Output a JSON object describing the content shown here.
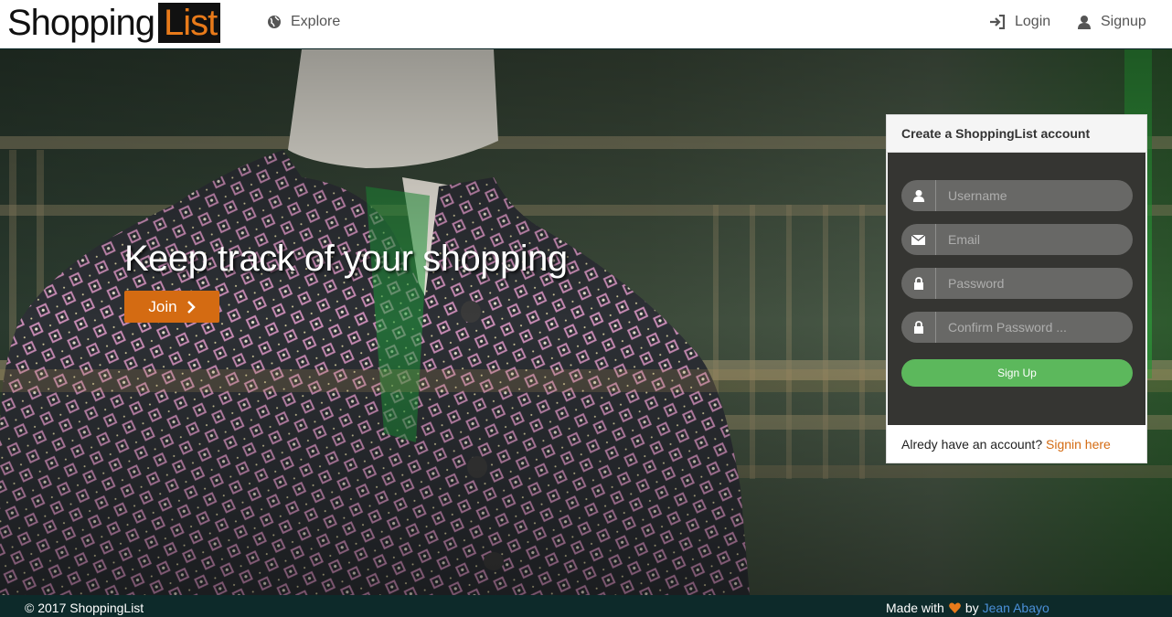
{
  "brand": {
    "part1": "Shopping",
    "part2": "List"
  },
  "nav": {
    "explore": "Explore",
    "login": "Login",
    "signup": "Signup"
  },
  "hero": {
    "title": "Keep track of your shopping",
    "join_label": "Join"
  },
  "signup_form": {
    "header": "Create a ShoppingList account",
    "username_placeholder": "Username",
    "email_placeholder": "Email",
    "password_placeholder": "Password",
    "confirm_placeholder": "Confirm Password ...",
    "submit_label": "Sign Up",
    "footer_text": "Alredy have an account?",
    "footer_link": "Signin here"
  },
  "footer": {
    "copyright": "© 2017 ShoppingList",
    "made_with": "Made with",
    "by": "by",
    "author": "Jean Abayo"
  },
  "colors": {
    "accent": "#d46b12",
    "success": "#5cb85c",
    "link": "#4a90d9",
    "footer_bg": "#0d2a2a"
  }
}
